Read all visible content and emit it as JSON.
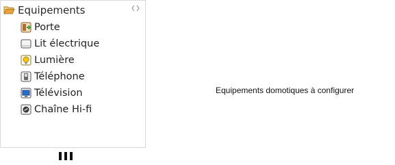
{
  "tree": {
    "root": {
      "label": "Equipements",
      "icon": "open-folder-icon",
      "toggle_icon": "double-chevron-icon"
    },
    "items": [
      {
        "label": "Porte",
        "icon": "door-icon"
      },
      {
        "label": "Lit électrique",
        "icon": "bed-icon"
      },
      {
        "label": "Lumière",
        "icon": "light-bulb-icon"
      },
      {
        "label": "Téléphone",
        "icon": "phone-icon"
      },
      {
        "label": "Télévision",
        "icon": "tv-icon"
      },
      {
        "label": "Chaîne Hi-fi",
        "icon": "speaker-icon"
      }
    ]
  },
  "main": {
    "caption": "Equipements domotiques à configurer"
  },
  "footer": {
    "more_indicator_icon": "vertical-ellipsis-icon"
  },
  "colors": {
    "folder": "#e8a33b",
    "door_green": "#3aa83a",
    "bulb_yellow": "#f5c518",
    "tv_blue": "#2b6cc4"
  }
}
